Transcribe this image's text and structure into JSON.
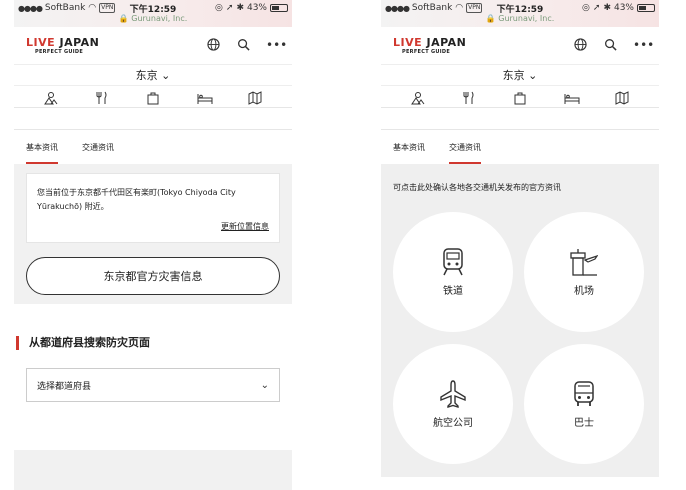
{
  "status": {
    "carrier": "SoftBank",
    "vpn": "VPN",
    "time": "下午12:59",
    "url": "Gurunavi, Inc.",
    "battery": "43%"
  },
  "header": {
    "logo_red_part": "LIVE",
    "logo_main": "JAPAN",
    "logo_sub": "PERFECT GUIDE"
  },
  "city": "东京",
  "icons": {
    "header": [
      "globe-icon",
      "search-icon",
      "more-icon"
    ],
    "categories": [
      "sightseeing-icon",
      "dining-icon",
      "shopping-icon",
      "hotel-icon",
      "map-icon"
    ]
  },
  "tabs": [
    "基本资讯",
    "交通资讯"
  ],
  "left": {
    "location_text": "您当前位于东京都千代田区有楽町(Tokyo Chiyoda City Yūrakuchō) 附近。",
    "update_location": "更新位置信息",
    "disaster_button": "东京都官方灾害信息",
    "section_title": "从都道府县搜索防灾页面",
    "select_placeholder": "选择都道府县"
  },
  "right": {
    "hint": "可点击此处确认各地各交通机关发布的官方资讯",
    "options": [
      {
        "label": "铁道",
        "icon": "train-icon"
      },
      {
        "label": "机场",
        "icon": "airport-icon"
      },
      {
        "label": "航空公司",
        "icon": "airplane-icon"
      },
      {
        "label": "巴士",
        "icon": "bus-icon"
      }
    ]
  },
  "colors": {
    "accent": "#d0382f",
    "panel_bg": "#f1f1f1"
  }
}
